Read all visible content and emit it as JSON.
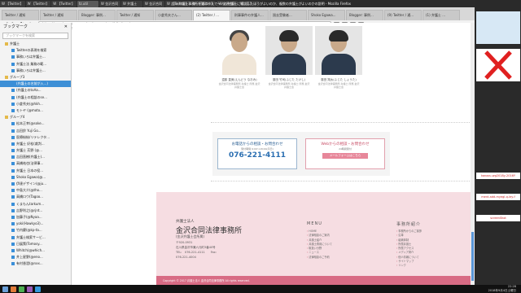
{
  "taskbar": {
    "items": [
      "W 【Twitter】",
      "W 【Twitter】",
      "W 【Twitter】",
      "tz.util",
      "W 金沢合同",
      "W 弁護士",
      "W 金沢合同",
      "W 【Twitter】",
      "W 【Twitter】",
      "W 金沢合同",
      "W 【1】"
    ],
    "window_title": "吉川 弁護士事務所を選ぶうえで一人の弁護士に相談したほうがよいのか、複数の弁護士がよいのかの説明 - Mozilla Firefox"
  },
  "browser": {
    "tabs": [
      "Twitter / 通知",
      "Twitter / 通知",
      "Blogger: 事例...",
      "Twitter / 通知",
      "小倉秀夫さん...",
      "(2) Twitter / ...",
      "刑事事件の弁護人...",
      "過去受験者...",
      "Shoko Egawa...",
      "Blogger: 事例...",
      "(9) Twitter / 通...",
      "(1) 弁護士 ..."
    ],
    "url": "https://www.kanazawagoudou.law.com/portfolio-item/...",
    "sidebar_title": "ブックマーク",
    "search_placeholder": "ブックマークを検索",
    "bookmarks": [
      {
        "label": "弁護士",
        "kind": "folder"
      },
      {
        "label": "Twitterの表現を検索",
        "kind": "item"
      },
      {
        "label": "事務いろは弁護士...",
        "kind": "item"
      },
      {
        "label": "弁護士法 業務の範...",
        "kind": "item"
      },
      {
        "label": "事務いろは弁護士...",
        "kind": "item"
      },
      {
        "label": "グループ3",
        "kind": "folder"
      },
      {
        "label": "(弁護士の名前が入...)",
        "kind": "selected"
      },
      {
        "label": "(弁護士のtoAa...",
        "kind": "item"
      },
      {
        "label": "(弁護士の相談のse...",
        "kind": "item"
      },
      {
        "label": "小倉秀夫(@hkh...",
        "kind": "item"
      },
      {
        "label": "モトヤ (@moto...",
        "kind": "item"
      },
      {
        "label": "グループ4",
        "kind": "folder"
      },
      {
        "label": "松本正幸(@soke...",
        "kind": "item"
      },
      {
        "label": "吉田鈴 Yuji Go...",
        "kind": "item"
      },
      {
        "label": "医療紛紛/リテレクタ...",
        "kind": "item"
      },
      {
        "label": "弁護士 好松(裁判...",
        "kind": "item"
      },
      {
        "label": "弁護士 芳野 (@...",
        "kind": "item"
      },
      {
        "label": "吉田直樹(弁護士)...",
        "kind": "item"
      },
      {
        "label": "高橋祐也(法律事...",
        "kind": "item"
      },
      {
        "label": "弁護士 日本の役...",
        "kind": "item"
      },
      {
        "label": "Shoko Egawa(@...",
        "kind": "item"
      },
      {
        "label": "伊達デザイン(@ju...",
        "kind": "item"
      },
      {
        "label": "中島大介(@tho...",
        "kind": "item"
      },
      {
        "label": "高橋ロウ(Tagoo...",
        "kind": "item"
      },
      {
        "label": "くまもんtarkum...",
        "kind": "item"
      },
      {
        "label": "吉野利之(@rjnt...",
        "kind": "item"
      },
      {
        "label": "加藤子(@Nyaa...",
        "kind": "item"
      },
      {
        "label": "yoki(Hawkyo3)...",
        "kind": "item"
      },
      {
        "label": "竹内慶(@kp-ta...",
        "kind": "item"
      },
      {
        "label": "弁護士検索サービ...",
        "kind": "item"
      },
      {
        "label": "日展策(Tomosy...",
        "kind": "item"
      },
      {
        "label": "Whitch(@which...",
        "kind": "item"
      },
      {
        "label": "井上星野(@eno...",
        "kind": "item"
      },
      {
        "label": "有村香澄(@nxx...",
        "kind": "item"
      }
    ]
  },
  "profiles": [
    {
      "name": "遠藤 直美(えんどう なおみ)",
      "desc": "金沢合同法律事務所 弁護士 所属 金沢弁護士会"
    },
    {
      "name": "藤田 竹司(ふじた たけし)",
      "desc": "金沢合同法律事務所 弁護士 所属 金沢弁護士会"
    },
    {
      "name": "藤田 翔太(ふじた しょうた)",
      "desc": "金沢合同法律事務所 弁護士 所属 金沢弁護士会"
    }
  ],
  "contact": {
    "phone_title": "お電話からの相談・お問合わせ",
    "phone_hours": "受付時間 9:00～18:00(平日)",
    "phone_number": "076-221-4111",
    "web_title": "Webからの相談・お問合わせ",
    "web_hours": "24時間受付",
    "web_button": "メールフォームはこちら"
  },
  "footer": {
    "logo_small": "弁護士法人",
    "logo": "金沢合同法律事務所",
    "sub": "(金沢弁護士会所属)",
    "postal": "〒920-0931",
    "address": "石川県金沢市兼六元町3番40号",
    "tel": "TEL:　076-221-4111　　Fax:",
    "fax": "076-221-4004",
    "menu_title": "MENU",
    "menu_items": [
      "HOME",
      "法律相談のご案内",
      "弁護士紹介",
      "弁護士費用について",
      "取扱い分野",
      "ニュース",
      "法律相談のご予約"
    ],
    "office_title": "事務所紹介",
    "office_items": [
      "事務所からのご挨拶",
      "沿革",
      "組織体制",
      "所属弁護士",
      "所属アクセス",
      "メディア掲介",
      "個人情報について",
      "サイトマップ",
      "リンク"
    ],
    "copyright": "Copyright © 2017 弁護士法人 金沢合同法律事務所 All rights reserved."
  },
  "desktop": {
    "labels": [
      "kanazu-wg2018y-2016Y",
      "ment-add-myegl-q-ley-f",
      "screenShot"
    ]
  },
  "clock": {
    "time": "22:28",
    "date": "2018年9月4日土曜日"
  }
}
